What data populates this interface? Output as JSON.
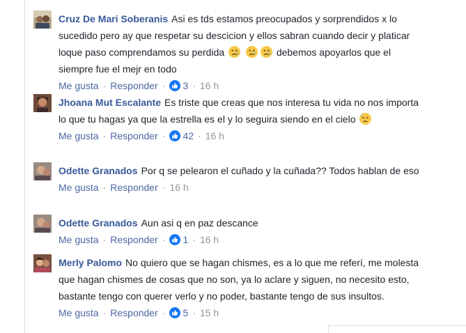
{
  "actions": {
    "like_label": "Me gusta",
    "reply_label": "Responder",
    "separator": "·"
  },
  "comments": [
    {
      "author": "Cruz De Mari Soberanis",
      "text_part1": "Asi es tds estamos preocupados y sorprendidos x lo sucedido pero ay que respetar su descicion y ellos sabran cuando decir y platicar loque paso comprendamos su perdida",
      "text_part2": "debemos apoyarlos que el siempre fue el mejr en todo",
      "reactions": "3",
      "time": "16 h"
    },
    {
      "author": "Jhoana Mut Escalante",
      "text_part1": "Es triste que creas que nos interesa tu vida no nos importa lo que tu hagas ya que la estrella es el y lo seguira siendo en el cielo",
      "reactions": "42",
      "time": "16 h"
    },
    {
      "author": "Odette Granados",
      "text_part1": "Por q se pelearon el cuñado y la cuñada?? Todos hablan de eso",
      "time": "16 h"
    },
    {
      "author": "Odette Granados",
      "text_part1": "Aun asi q en paz descance",
      "reactions": "1",
      "time": "16 h"
    },
    {
      "author": "Merly Palomo",
      "text_part1": "No quiero que se hagan chismes, es a lo que me referí, me molesta que hagan chismes de cosas que no son, ya lo aclare y siguen, no necesito esto, bastante tengo con querer verlo y no poder, bastante tengo de sus insultos.",
      "reactions": "5",
      "time": "15 h"
    }
  ],
  "colors": {
    "author": "#385898",
    "link": "#4b67a1",
    "meta": "#90949c",
    "like_blue": "#1877f2"
  },
  "icons": {
    "like": "thumbs-up-icon",
    "cry": "crying-face-icon",
    "sad": "sad-face-icon"
  }
}
